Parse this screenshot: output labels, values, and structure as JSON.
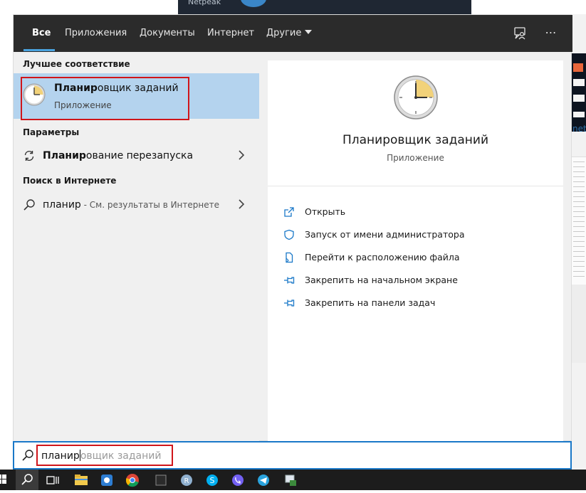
{
  "background": {
    "top_window_label": "Netpeak",
    "right_link_text": "netp"
  },
  "tabs": [
    {
      "label": "Все",
      "active": true
    },
    {
      "label": "Приложения"
    },
    {
      "label": "Документы"
    },
    {
      "label": "Интернет"
    },
    {
      "label": "Другие"
    }
  ],
  "left": {
    "best_match_label": "Лучшее соответствие",
    "best_match": {
      "title_bold": "Планир",
      "title_rest": "овщик заданий",
      "subtitle": "Приложение"
    },
    "settings_label": "Параметры",
    "settings_item": {
      "bold": "Планир",
      "rest": "ование перезапуска"
    },
    "web_label": "Поиск в Интернете",
    "web_item": {
      "query": "планир",
      "suffix": " - См. результаты в Интернете"
    }
  },
  "right": {
    "title": "Планировщик заданий",
    "subtitle": "Приложение",
    "actions": [
      {
        "label": "Открыть",
        "icon": "open-icon"
      },
      {
        "label": "Запуск от имени администратора",
        "icon": "shield-icon"
      },
      {
        "label": "Перейти к расположению файла",
        "icon": "file-location-icon"
      },
      {
        "label": "Закрепить на начальном экране",
        "icon": "pin-icon"
      },
      {
        "label": "Закрепить на панели задач",
        "icon": "pin-icon"
      }
    ]
  },
  "search": {
    "typed": "планир",
    "suggestion": "овщик заданий"
  },
  "colors": {
    "accent": "#1a78c8",
    "highlight": "#d0151a",
    "selected": "#b4d3ee",
    "tabbar": "#2b2b2b"
  }
}
